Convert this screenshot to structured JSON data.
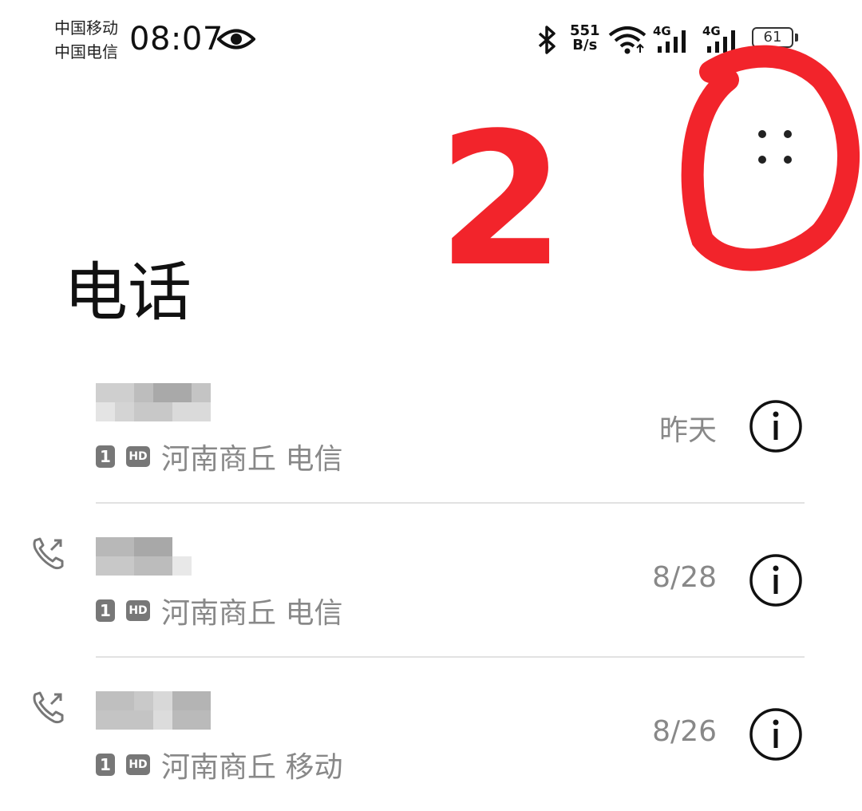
{
  "status_bar": {
    "carrier_1": "中国移动",
    "carrier_2": "中国电信",
    "time": "08:07",
    "net_speed_value": "551",
    "net_speed_unit": "B/s",
    "signal_1_label": "4G",
    "signal_2_label": "4G",
    "battery_level": "61",
    "icons": [
      "eye-icon",
      "bluetooth-icon",
      "wifi-icon",
      "signal-icon",
      "battery-icon"
    ]
  },
  "header": {
    "title": "电话",
    "more_icon": "more-dots-icon"
  },
  "annotation": {
    "number": "2",
    "color": "#f2242b"
  },
  "calls": [
    {
      "sim": "1",
      "hd": "HD",
      "location": "河南商丘 电信",
      "date": "昨天",
      "outgoing": false
    },
    {
      "sim": "1",
      "hd": "HD",
      "location": "河南商丘 电信",
      "date": "8/28",
      "outgoing": true
    },
    {
      "sim": "1",
      "hd": "HD",
      "location": "河南商丘 移动",
      "date": "8/26",
      "outgoing": true
    }
  ],
  "colors": {
    "secondary_text": "#888888",
    "divider": "#e2e2e2",
    "badge": "#777777"
  }
}
